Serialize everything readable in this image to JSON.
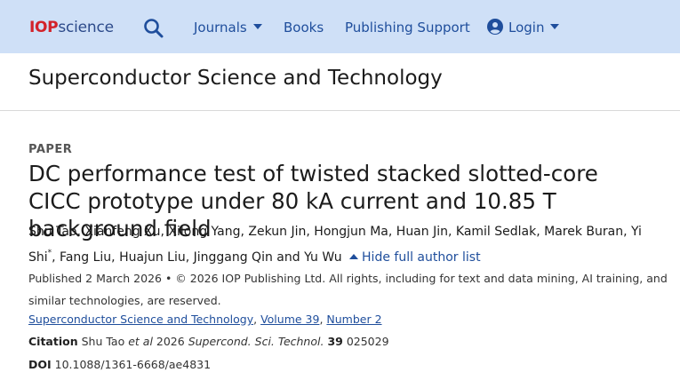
{
  "header": {
    "logo_iop": "IOP",
    "logo_science": "science",
    "nav": {
      "journals": "Journals",
      "books": "Books",
      "support": "Publishing Support",
      "login": "Login"
    }
  },
  "journal": {
    "title": "Superconductor Science and Technology"
  },
  "article": {
    "type": "PAPER",
    "title": "DC performance test of twisted stacked slotted-core CICC prototype under 80 kA current and 10.85 T background field",
    "authors_line": "Shu Tao, Xianfeng Xu, Xilong Yang, Zekun Jin, Hongjun Ma, Huan Jin, Kamil Sedlak, Marek Buran, Yi Shi",
    "authors_sup": "*",
    "authors_tail": ", Fang Liu, Huajun Liu, Jinggang Qin and Yu Wu",
    "hide_authors": "Hide full author list",
    "published": "Published 2 March 2026 • © 2026 IOP Publishing Ltd. All rights, including for text and data mining, AI training, and similar technologies, are reserved.",
    "journal_link": "Superconductor Science and Technology",
    "volume_link": "Volume 39",
    "number_link": "Number 2",
    "citation_label": "Citation",
    "citation_authors": "Shu Tao ",
    "citation_etal": "et al",
    "citation_year": " 2026 ",
    "citation_journal": "Supercond. Sci. Technol.",
    "citation_volume": "39",
    "citation_article": " 025029",
    "doi_label": "DOI",
    "doi_value": "10.1088/1361-6668/ae4831"
  },
  "colors": {
    "header_bg": "#cfe0f7",
    "link": "#1f4e9c",
    "logo_red": "#d3222a"
  }
}
